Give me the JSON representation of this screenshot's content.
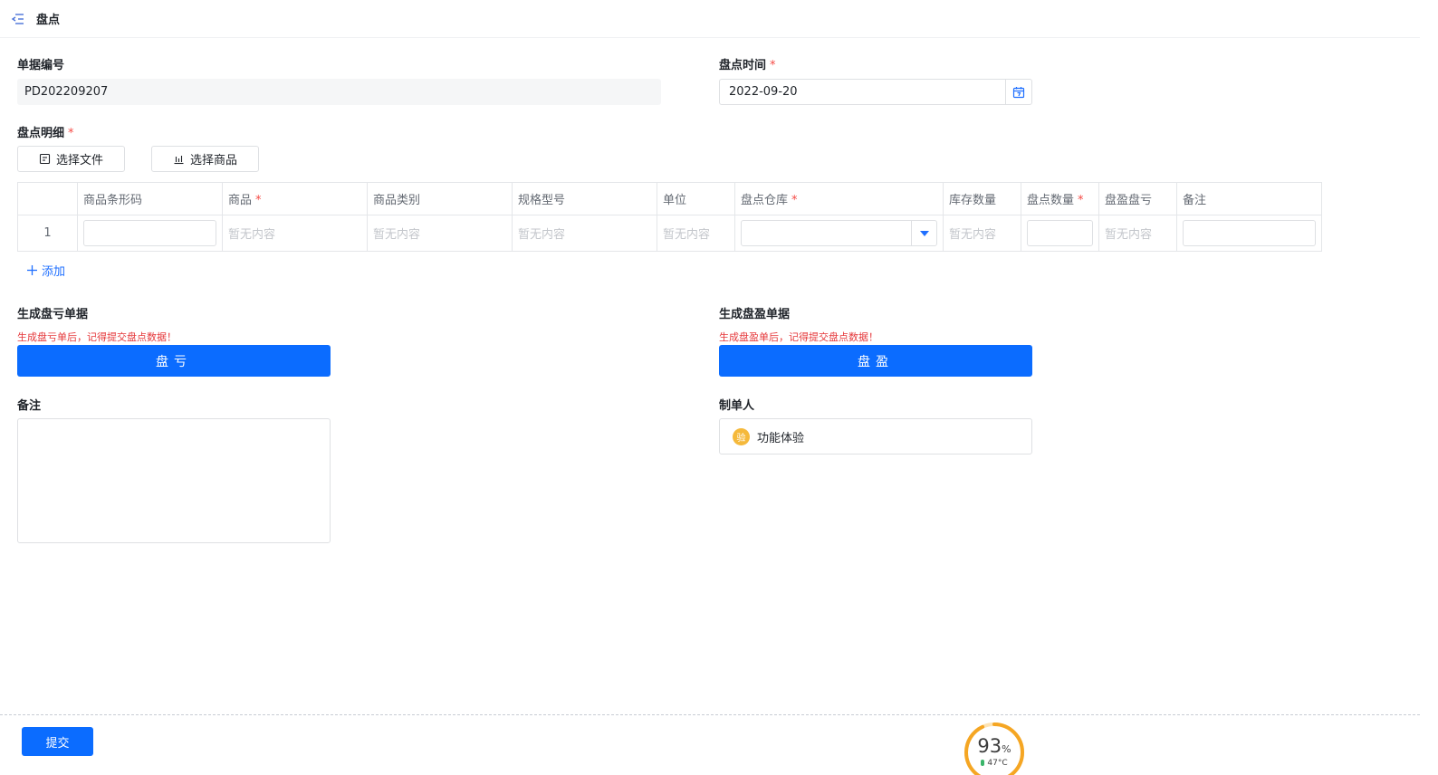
{
  "header": {
    "title": "盘点"
  },
  "doc_no": {
    "label": "单据编号",
    "value": "PD202209207"
  },
  "doc_time": {
    "label": "盘点时间",
    "required": "*",
    "value": "2022-09-20"
  },
  "detail": {
    "label": "盘点明细",
    "required": "*",
    "select_file": "选择文件",
    "select_goods": "选择商品",
    "columns": [
      {
        "label": "",
        "required": ""
      },
      {
        "label": "商品条形码",
        "required": ""
      },
      {
        "label": "商品",
        "required": "*"
      },
      {
        "label": "商品类别",
        "required": ""
      },
      {
        "label": "规格型号",
        "required": ""
      },
      {
        "label": "单位",
        "required": ""
      },
      {
        "label": "盘点仓库",
        "required": "*"
      },
      {
        "label": "库存数量",
        "required": ""
      },
      {
        "label": "盘点数量",
        "required": "*"
      },
      {
        "label": "盘盈盘亏",
        "required": ""
      },
      {
        "label": "备注",
        "required": ""
      }
    ],
    "row": {
      "index": "1",
      "empty": "暂无内容"
    },
    "add": "添加"
  },
  "loss": {
    "label": "生成盘亏单据",
    "warning": "生成盘亏单后，记得提交盘点数据！",
    "button": "盘亏"
  },
  "gain": {
    "label": "生成盘盈单据",
    "warning": "生成盘盈单后，记得提交盘点数据！",
    "button": "盘盈"
  },
  "remark": {
    "label": "备注"
  },
  "creator": {
    "label": "制单人",
    "avatar": "验",
    "name": "功能体验"
  },
  "submit": "提交",
  "gauge": {
    "percent": "93",
    "unit": "%",
    "temp": "47°C",
    "fraction": 0.93
  },
  "colors": {
    "primary": "#0b6cff",
    "warning": "#e5373a",
    "required": "#f54a45"
  }
}
